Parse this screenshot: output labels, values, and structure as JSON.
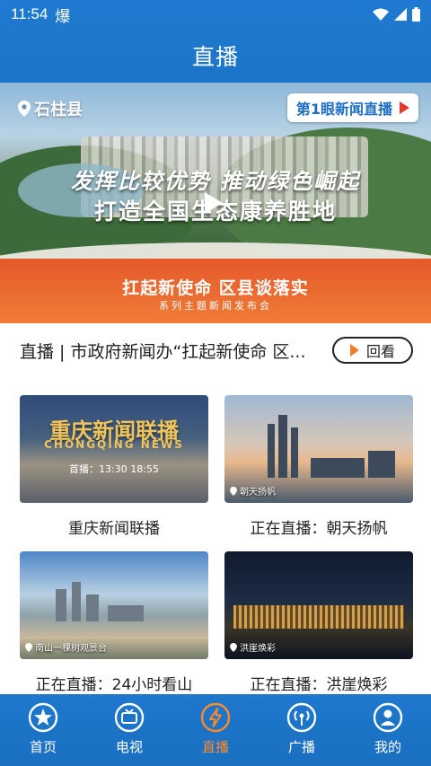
{
  "status_bar": {
    "time": "11:54",
    "carrier_glyph": "爆"
  },
  "header": {
    "title": "直播"
  },
  "hero": {
    "location": "石柱县",
    "live_badge": "第1眼新闻直播",
    "slogan_line1": "发挥比较优势 推动绿色崛起",
    "slogan_line2": "打造全国生态康养胜地",
    "band_title": "扛起新使命 区县谈落实",
    "band_subtitle": "系列主题新闻发布会"
  },
  "news": {
    "text": "直播 | 市政府新闻办“扛起新使命 区...",
    "replay_label": "回看"
  },
  "cards": [
    {
      "caption": "重庆新闻联播",
      "thumb_title": "重庆新闻联播",
      "thumb_en": "CHONGQING NEWS",
      "thumb_time": "首播：13:30 18:55"
    },
    {
      "caption": "正在直播：朝天扬帆",
      "pin": "朝天扬帆"
    },
    {
      "caption": "正在直播：24小时看山",
      "pin": "南山一棵树观景台"
    },
    {
      "caption": "正在直播：洪崖焕彩",
      "pin": "洪崖焕彩"
    }
  ],
  "tabs": [
    {
      "label": "首页",
      "icon": "star-icon"
    },
    {
      "label": "电视",
      "icon": "tv-icon"
    },
    {
      "label": "直播",
      "icon": "lightning-icon"
    },
    {
      "label": "广播",
      "icon": "broadcast-icon"
    },
    {
      "label": "我的",
      "icon": "user-icon"
    }
  ],
  "colors": {
    "brand_blue": "#1e78ce",
    "active_orange": "#ff8a2a",
    "live_red": "#e53a2a"
  }
}
